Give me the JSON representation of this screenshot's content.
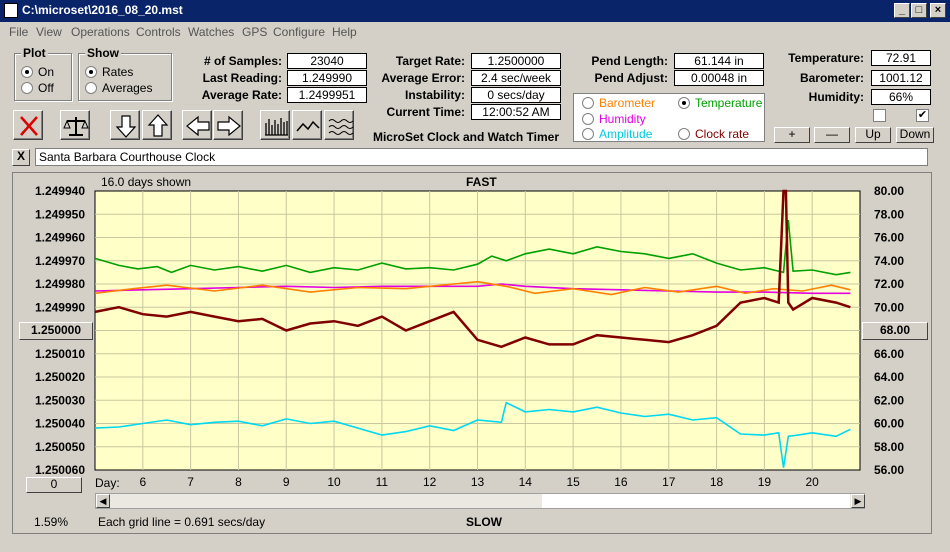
{
  "window": {
    "title": "C:\\microset\\2016_08_20.mst"
  },
  "menu": [
    "File",
    "View",
    "Operations",
    "Controls",
    "Watches",
    "GPS",
    "Configure",
    "Help"
  ],
  "plot_group": {
    "title": "Plot",
    "options": [
      "On",
      "Off"
    ],
    "selected": "On"
  },
  "show_group": {
    "title": "Show",
    "options": [
      "Rates",
      "Averages"
    ],
    "selected": "Rates"
  },
  "stats": {
    "samples_label": "# of Samples:",
    "samples": "23040",
    "last_label": "Last Reading:",
    "last": "1.249990",
    "avg_label": "Average Rate:",
    "avg": "1.2499951",
    "target_label": "Target Rate:",
    "target": "1.2500000",
    "avgerr_label": "Average Error:",
    "avgerr": "2.4 sec/week",
    "instab_label": "Instability:",
    "instab": "0 secs/day",
    "curtime_label": "Current Time:",
    "curtime": "12:00:52 AM",
    "pendlen_label": "Pend Length:",
    "pendlen": "61.144 in",
    "pendadj_label": "Pend Adjust:",
    "pendadj": "0.00048 in",
    "temp_label": "Temperature:",
    "temp": "72.91",
    "baro_label": "Barometer:",
    "baro": "1001.12",
    "hum_label": "Humidity:",
    "hum": "66%"
  },
  "app_caption": "MicroSet Clock and Watch Timer",
  "sensor_select": {
    "options": [
      {
        "label": "Barometer",
        "color": "#ff8000",
        "selected": false
      },
      {
        "label": "Temperature",
        "color": "#00a000",
        "selected": true
      },
      {
        "label": "Humidity",
        "color": "#e000e0",
        "selected": false
      },
      {
        "label": "Clock rate",
        "color": "#800000",
        "selected": false
      },
      {
        "label": "Amplitude",
        "color": "#00c8e0",
        "selected": false
      }
    ]
  },
  "scale_buttons": {
    "plus": "+",
    "minus": "—",
    "up": "Up",
    "down": "Down"
  },
  "checkboxes": [
    {
      "checked": false
    },
    {
      "checked": true
    }
  ],
  "clock_name": "Santa Barbara Courthouse Clock",
  "close_x": "X",
  "chart_header": {
    "days_shown": "16.0 days shown",
    "fast": "FAST",
    "slow": "SLOW",
    "grid_note": "Each grid line = 0.691 secs/day",
    "percent": "1.59%"
  },
  "left_button": "1.250000",
  "right_button": "68.00",
  "bottom_left_button": "0",
  "day_label": "Day:",
  "chart_data": {
    "type": "line",
    "title": "",
    "xlabel": "Day",
    "x_ticks": [
      6,
      7,
      8,
      9,
      10,
      11,
      12,
      13,
      14,
      15,
      16,
      17,
      18,
      19,
      20
    ],
    "xlim": [
      5.0,
      21.0
    ],
    "y_left_ticks": [
      "1.249940",
      "1.249950",
      "1.249960",
      "1.249970",
      "1.249980",
      "1.249990",
      "1.250000",
      "1.250010",
      "1.250020",
      "1.250030",
      "1.250040",
      "1.250050",
      "1.250060"
    ],
    "y_left_range": [
      1.24994,
      1.25006
    ],
    "y_left_inverted": true,
    "y_right_ticks": [
      "80.00",
      "78.00",
      "76.00",
      "74.00",
      "72.00",
      "70.00",
      "68.00",
      "66.00",
      "64.00",
      "62.00",
      "60.00",
      "58.00",
      "56.00"
    ],
    "y_right_range": [
      56,
      80
    ],
    "grid": true,
    "background": "#ffffc8",
    "series": [
      {
        "name": "Temperature",
        "color": "#00a000",
        "axis": "right",
        "x": [
          5.0,
          5.5,
          5.9,
          6.3,
          6.6,
          7.0,
          7.5,
          8.0,
          8.5,
          9.0,
          9.5,
          10.0,
          10.5,
          11.0,
          11.5,
          12.0,
          12.5,
          13.0,
          13.3,
          13.6,
          14.0,
          14.5,
          15.0,
          15.5,
          16.0,
          16.5,
          17.0,
          17.5,
          18.0,
          18.5,
          19.0,
          19.4,
          19.5,
          19.6,
          20.0,
          20.5,
          20.8
        ],
        "y": [
          74.2,
          73.6,
          73.3,
          73.5,
          73.0,
          73.6,
          73.2,
          73.5,
          73.1,
          73.6,
          73.0,
          73.4,
          73.2,
          73.8,
          73.3,
          73.4,
          73.2,
          73.7,
          74.4,
          74.0,
          74.6,
          75.0,
          74.6,
          75.2,
          74.8,
          74.6,
          74.2,
          74.6,
          73.8,
          73.2,
          73.4,
          73.0,
          77.5,
          73.1,
          73.2,
          72.8,
          73.0
        ]
      },
      {
        "name": "Humidity",
        "color": "#e000e0",
        "axis": "right",
        "x": [
          5.0,
          6.0,
          7.0,
          8.0,
          9.0,
          10.0,
          11.0,
          12.0,
          13.0,
          13.5,
          14.0,
          15.0,
          16.0,
          17.0,
          18.0,
          19.0,
          20.0,
          20.8
        ],
        "y": [
          71.4,
          71.5,
          71.6,
          71.7,
          71.8,
          71.7,
          71.8,
          71.8,
          71.8,
          72.0,
          71.8,
          71.6,
          71.5,
          71.4,
          71.3,
          71.3,
          71.2,
          71.2
        ]
      },
      {
        "name": "Barometer",
        "color": "#ff8000",
        "axis": "right",
        "x": [
          5.0,
          5.8,
          6.5,
          7.5,
          8.5,
          9.5,
          10.5,
          11.5,
          12.5,
          13.0,
          13.6,
          14.2,
          15.0,
          15.8,
          16.5,
          17.2,
          18.0,
          18.6,
          19.2,
          19.8,
          20.4,
          20.8
        ],
        "y": [
          71.2,
          71.6,
          71.9,
          71.4,
          71.9,
          71.3,
          71.7,
          71.6,
          72.0,
          72.2,
          71.8,
          71.2,
          71.6,
          71.1,
          71.7,
          71.3,
          71.8,
          71.2,
          71.6,
          71.4,
          71.9,
          71.5
        ]
      },
      {
        "name": "Clock rate",
        "color": "#800000",
        "axis": "left",
        "x": [
          5.0,
          5.5,
          6.0,
          6.5,
          7.0,
          7.5,
          8.0,
          8.5,
          9.0,
          9.5,
          10.0,
          10.5,
          11.0,
          11.5,
          12.0,
          12.5,
          13.0,
          13.5,
          14.0,
          14.5,
          15.0,
          15.5,
          16.0,
          16.5,
          17.0,
          17.5,
          18.0,
          18.5,
          19.0,
          19.3,
          19.4,
          19.45,
          19.5,
          19.6,
          20.0,
          20.5,
          20.8
        ],
        "y": [
          1.249992,
          1.24999,
          1.249993,
          1.249994,
          1.249992,
          1.249994,
          1.249996,
          1.249995,
          1.25,
          1.249997,
          1.249996,
          1.249998,
          1.249994,
          1.25,
          1.249996,
          1.249992,
          1.250004,
          1.250007,
          1.250003,
          1.250006,
          1.250006,
          1.250002,
          1.250003,
          1.250004,
          1.250005,
          1.250002,
          1.249998,
          1.249988,
          1.249986,
          1.249988,
          1.24994,
          1.24994,
          1.249988,
          1.249991,
          1.249986,
          1.249988,
          1.24999
        ]
      },
      {
        "name": "Amplitude",
        "color": "#00d8f0",
        "axis": "right",
        "x": [
          5.0,
          5.5,
          6.0,
          6.5,
          7.0,
          7.5,
          8.0,
          8.5,
          9.0,
          9.5,
          10.0,
          10.5,
          11.0,
          11.5,
          12.0,
          12.5,
          13.0,
          13.5,
          13.6,
          14.0,
          14.5,
          15.0,
          15.5,
          16.0,
          16.5,
          17.0,
          17.5,
          18.0,
          18.5,
          19.0,
          19.3,
          19.4,
          19.5,
          19.7,
          20.0,
          20.5,
          20.8
        ],
        "y": [
          59.6,
          59.7,
          60.0,
          60.3,
          59.9,
          60.1,
          60.2,
          59.8,
          60.4,
          60.0,
          60.2,
          59.6,
          59.0,
          59.3,
          59.8,
          59.4,
          60.3,
          60.1,
          61.8,
          61.0,
          61.2,
          61.0,
          61.4,
          60.9,
          60.6,
          60.8,
          60.3,
          60.5,
          59.1,
          59.0,
          59.2,
          56.2,
          58.9,
          59.0,
          59.2,
          58.9,
          59.5
        ]
      }
    ]
  }
}
